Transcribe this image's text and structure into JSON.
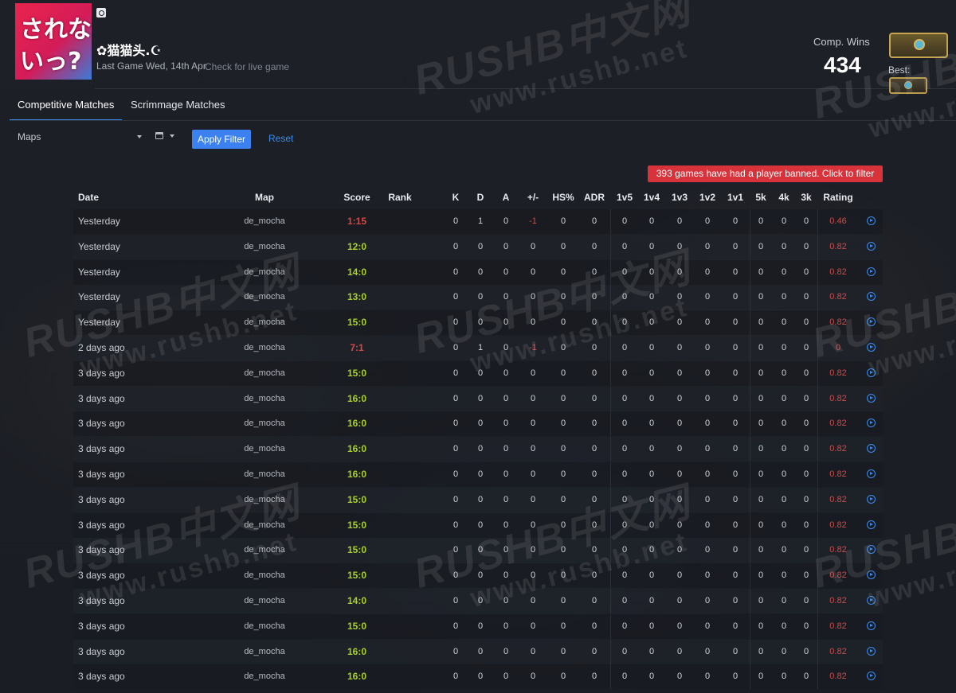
{
  "colors": {
    "accent": "#3b82f0",
    "win_score": "#a8d124",
    "loss_score": "#d04a4a",
    "rating": "#d04a4a",
    "banned_bg": "#d8323b"
  },
  "profile": {
    "name": "✿猫猫头.☪",
    "last_game": "Last Game Wed, 14th Apr",
    "live_link": "Check for live game",
    "avatar_text": "されないっ?",
    "platform_icon": "steam-icon"
  },
  "stats": {
    "comp_wins_label": "Comp. Wins",
    "comp_wins_value": "434",
    "best_label": "Best:",
    "rank_icon": "rank-badge-icon"
  },
  "tabs": [
    {
      "label": "Competitive Matches",
      "active": true
    },
    {
      "label": "Scrimmage Matches",
      "active": false
    }
  ],
  "filters": {
    "maps_label": "Maps",
    "apply_label": "Apply Filter",
    "reset_label": "Reset"
  },
  "notice": "393 games have had a player banned. Click to filter",
  "watermark": {
    "brand": "RUSHB中文网",
    "url": "www.rushb.net"
  },
  "table": {
    "headers": [
      "Date",
      "Map",
      "Score",
      "Rank",
      "K",
      "D",
      "A",
      "+/-",
      "HS%",
      "ADR",
      "1v5",
      "1v4",
      "1v3",
      "1v2",
      "1v1",
      "5k",
      "4k",
      "3k",
      "Rating"
    ],
    "rows": [
      {
        "date": "Yesterday",
        "map": "de_mocha",
        "score": "1:15",
        "win": false,
        "rank": "",
        "k": "0",
        "d": "1",
        "a": "0",
        "pm": "-1",
        "hs": "0",
        "adr": "0",
        "v5": "0",
        "v4": "0",
        "v3": "0",
        "v2": "0",
        "v1": "0",
        "k5": "0",
        "k4": "0",
        "k3": "0",
        "rating": "0.46"
      },
      {
        "date": "Yesterday",
        "map": "de_mocha",
        "score": "12:0",
        "win": true,
        "rank": "",
        "k": "0",
        "d": "0",
        "a": "0",
        "pm": "0",
        "hs": "0",
        "adr": "0",
        "v5": "0",
        "v4": "0",
        "v3": "0",
        "v2": "0",
        "v1": "0",
        "k5": "0",
        "k4": "0",
        "k3": "0",
        "rating": "0.82"
      },
      {
        "date": "Yesterday",
        "map": "de_mocha",
        "score": "14:0",
        "win": true,
        "rank": "",
        "k": "0",
        "d": "0",
        "a": "0",
        "pm": "0",
        "hs": "0",
        "adr": "0",
        "v5": "0",
        "v4": "0",
        "v3": "0",
        "v2": "0",
        "v1": "0",
        "k5": "0",
        "k4": "0",
        "k3": "0",
        "rating": "0.82"
      },
      {
        "date": "Yesterday",
        "map": "de_mocha",
        "score": "13:0",
        "win": true,
        "rank": "",
        "k": "0",
        "d": "0",
        "a": "0",
        "pm": "0",
        "hs": "0",
        "adr": "0",
        "v5": "0",
        "v4": "0",
        "v3": "0",
        "v2": "0",
        "v1": "0",
        "k5": "0",
        "k4": "0",
        "k3": "0",
        "rating": "0.82"
      },
      {
        "date": "Yesterday",
        "map": "de_mocha",
        "score": "15:0",
        "win": true,
        "rank": "",
        "k": "0",
        "d": "0",
        "a": "0",
        "pm": "0",
        "hs": "0",
        "adr": "0",
        "v5": "0",
        "v4": "0",
        "v3": "0",
        "v2": "0",
        "v1": "0",
        "k5": "0",
        "k4": "0",
        "k3": "0",
        "rating": "0.82"
      },
      {
        "date": "2 days ago",
        "map": "de_mocha",
        "score": "7:1",
        "win": false,
        "rank": "",
        "k": "0",
        "d": "1",
        "a": "0",
        "pm": "-1",
        "hs": "0",
        "adr": "0",
        "v5": "0",
        "v4": "0",
        "v3": "0",
        "v2": "0",
        "v1": "0",
        "k5": "0",
        "k4": "0",
        "k3": "0",
        "rating": "0"
      },
      {
        "date": "3 days ago",
        "map": "de_mocha",
        "score": "15:0",
        "win": true,
        "rank": "",
        "k": "0",
        "d": "0",
        "a": "0",
        "pm": "0",
        "hs": "0",
        "adr": "0",
        "v5": "0",
        "v4": "0",
        "v3": "0",
        "v2": "0",
        "v1": "0",
        "k5": "0",
        "k4": "0",
        "k3": "0",
        "rating": "0.82"
      },
      {
        "date": "3 days ago",
        "map": "de_mocha",
        "score": "16:0",
        "win": true,
        "rank": "",
        "k": "0",
        "d": "0",
        "a": "0",
        "pm": "0",
        "hs": "0",
        "adr": "0",
        "v5": "0",
        "v4": "0",
        "v3": "0",
        "v2": "0",
        "v1": "0",
        "k5": "0",
        "k4": "0",
        "k3": "0",
        "rating": "0.82"
      },
      {
        "date": "3 days ago",
        "map": "de_mocha",
        "score": "16:0",
        "win": true,
        "rank": "",
        "k": "0",
        "d": "0",
        "a": "0",
        "pm": "0",
        "hs": "0",
        "adr": "0",
        "v5": "0",
        "v4": "0",
        "v3": "0",
        "v2": "0",
        "v1": "0",
        "k5": "0",
        "k4": "0",
        "k3": "0",
        "rating": "0.82"
      },
      {
        "date": "3 days ago",
        "map": "de_mocha",
        "score": "16:0",
        "win": true,
        "rank": "",
        "k": "0",
        "d": "0",
        "a": "0",
        "pm": "0",
        "hs": "0",
        "adr": "0",
        "v5": "0",
        "v4": "0",
        "v3": "0",
        "v2": "0",
        "v1": "0",
        "k5": "0",
        "k4": "0",
        "k3": "0",
        "rating": "0.82"
      },
      {
        "date": "3 days ago",
        "map": "de_mocha",
        "score": "16:0",
        "win": true,
        "rank": "",
        "k": "0",
        "d": "0",
        "a": "0",
        "pm": "0",
        "hs": "0",
        "adr": "0",
        "v5": "0",
        "v4": "0",
        "v3": "0",
        "v2": "0",
        "v1": "0",
        "k5": "0",
        "k4": "0",
        "k3": "0",
        "rating": "0.82"
      },
      {
        "date": "3 days ago",
        "map": "de_mocha",
        "score": "15:0",
        "win": true,
        "rank": "",
        "k": "0",
        "d": "0",
        "a": "0",
        "pm": "0",
        "hs": "0",
        "adr": "0",
        "v5": "0",
        "v4": "0",
        "v3": "0",
        "v2": "0",
        "v1": "0",
        "k5": "0",
        "k4": "0",
        "k3": "0",
        "rating": "0.82"
      },
      {
        "date": "3 days ago",
        "map": "de_mocha",
        "score": "15:0",
        "win": true,
        "rank": "",
        "k": "0",
        "d": "0",
        "a": "0",
        "pm": "0",
        "hs": "0",
        "adr": "0",
        "v5": "0",
        "v4": "0",
        "v3": "0",
        "v2": "0",
        "v1": "0",
        "k5": "0",
        "k4": "0",
        "k3": "0",
        "rating": "0.82"
      },
      {
        "date": "3 days ago",
        "map": "de_mocha",
        "score": "15:0",
        "win": true,
        "rank": "",
        "k": "0",
        "d": "0",
        "a": "0",
        "pm": "0",
        "hs": "0",
        "adr": "0",
        "v5": "0",
        "v4": "0",
        "v3": "0",
        "v2": "0",
        "v1": "0",
        "k5": "0",
        "k4": "0",
        "k3": "0",
        "rating": "0.82"
      },
      {
        "date": "3 days ago",
        "map": "de_mocha",
        "score": "15:0",
        "win": true,
        "rank": "",
        "k": "0",
        "d": "0",
        "a": "0",
        "pm": "0",
        "hs": "0",
        "adr": "0",
        "v5": "0",
        "v4": "0",
        "v3": "0",
        "v2": "0",
        "v1": "0",
        "k5": "0",
        "k4": "0",
        "k3": "0",
        "rating": "0.82"
      },
      {
        "date": "3 days ago",
        "map": "de_mocha",
        "score": "14:0",
        "win": true,
        "rank": "",
        "k": "0",
        "d": "0",
        "a": "0",
        "pm": "0",
        "hs": "0",
        "adr": "0",
        "v5": "0",
        "v4": "0",
        "v3": "0",
        "v2": "0",
        "v1": "0",
        "k5": "0",
        "k4": "0",
        "k3": "0",
        "rating": "0.82"
      },
      {
        "date": "3 days ago",
        "map": "de_mocha",
        "score": "15:0",
        "win": true,
        "rank": "",
        "k": "0",
        "d": "0",
        "a": "0",
        "pm": "0",
        "hs": "0",
        "adr": "0",
        "v5": "0",
        "v4": "0",
        "v3": "0",
        "v2": "0",
        "v1": "0",
        "k5": "0",
        "k4": "0",
        "k3": "0",
        "rating": "0.82"
      },
      {
        "date": "3 days ago",
        "map": "de_mocha",
        "score": "16:0",
        "win": true,
        "rank": "",
        "k": "0",
        "d": "0",
        "a": "0",
        "pm": "0",
        "hs": "0",
        "adr": "0",
        "v5": "0",
        "v4": "0",
        "v3": "0",
        "v2": "0",
        "v1": "0",
        "k5": "0",
        "k4": "0",
        "k3": "0",
        "rating": "0.82"
      },
      {
        "date": "3 days ago",
        "map": "de_mocha",
        "score": "16:0",
        "win": true,
        "rank": "",
        "k": "0",
        "d": "0",
        "a": "0",
        "pm": "0",
        "hs": "0",
        "adr": "0",
        "v5": "0",
        "v4": "0",
        "v3": "0",
        "v2": "0",
        "v1": "0",
        "k5": "0",
        "k4": "0",
        "k3": "0",
        "rating": "0.82"
      }
    ]
  }
}
